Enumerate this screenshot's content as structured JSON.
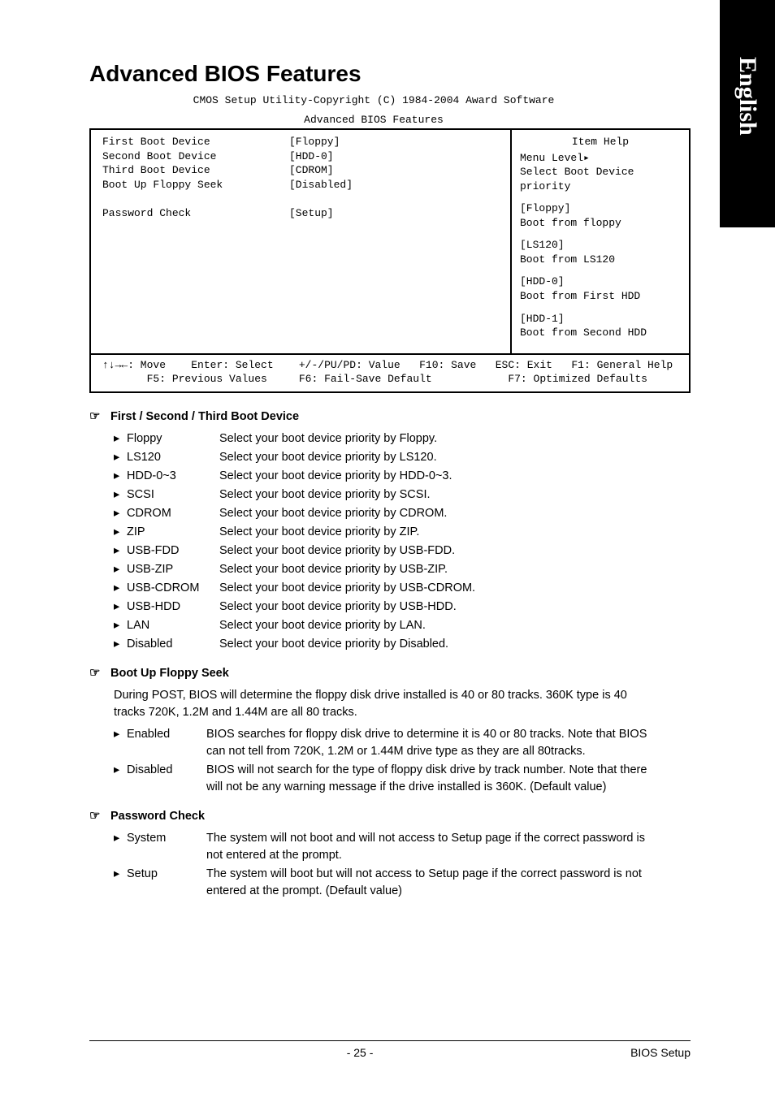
{
  "sideTab": "English",
  "title": "Advanced BIOS Features",
  "biosHeader1": "CMOS Setup Utility-Copyright (C) 1984-2004 Award Software",
  "biosHeader2": "Advanced BIOS Features",
  "biosSettings": [
    {
      "label": "First Boot Device",
      "value": "[Floppy]"
    },
    {
      "label": "Second Boot Device",
      "value": "[HDD-0]"
    },
    {
      "label": "Third Boot Device",
      "value": "[CDROM]"
    },
    {
      "label": "Boot Up Floppy Seek",
      "value": "[Disabled]"
    },
    {
      "label": "",
      "value": ""
    },
    {
      "label": "Password Check",
      "value": "[Setup]"
    }
  ],
  "help": {
    "title": "Item Help",
    "menuLevel": "Menu Level▸",
    "desc": "Select Boot Device priority",
    "items": [
      {
        "opt": "[Floppy]",
        "txt": "Boot from floppy"
      },
      {
        "opt": "[LS120]",
        "txt": "Boot from LS120"
      },
      {
        "opt": "[HDD-0]",
        "txt": "Boot from First HDD"
      },
      {
        "opt": "[HDD-1]",
        "txt": "Boot from Second HDD"
      }
    ]
  },
  "footerKeys": {
    "l1a": "↑↓→←: Move",
    "l1b": "Enter: Select",
    "l1c": "+/-/PU/PD: Value",
    "l1d": "F10: Save",
    "l1e": "ESC: Exit",
    "l1f": "F1: General Help",
    "l2a": "F5: Previous Values",
    "l2b": "F6: Fail-Save Default",
    "l2c": "F7: Optimized Defaults"
  },
  "sec1": {
    "title": "First / Second / Third Boot Device",
    "rows": [
      {
        "name": "Floppy",
        "desc": "Select your boot device priority by Floppy."
      },
      {
        "name": "LS120",
        "desc": "Select your boot device priority by LS120."
      },
      {
        "name": "HDD-0~3",
        "desc": "Select your boot device priority by HDD-0~3."
      },
      {
        "name": "SCSI",
        "desc": "Select your boot device priority by SCSI."
      },
      {
        "name": "CDROM",
        "desc": "Select your boot device priority by CDROM."
      },
      {
        "name": "ZIP",
        "desc": "Select your boot device priority by ZIP."
      },
      {
        "name": "USB-FDD",
        "desc": "Select your boot device priority by USB-FDD."
      },
      {
        "name": "USB-ZIP",
        "desc": "Select your boot device priority by USB-ZIP."
      },
      {
        "name": "USB-CDROM",
        "desc": "Select your boot device priority by USB-CDROM."
      },
      {
        "name": "USB-HDD",
        "desc": "Select your boot device priority by USB-HDD."
      },
      {
        "name": "LAN",
        "desc": "Select your boot device priority by LAN."
      },
      {
        "name": "Disabled",
        "desc": "Select your boot device priority by Disabled."
      }
    ]
  },
  "sec2": {
    "title": "Boot Up Floppy Seek",
    "intro": "During POST, BIOS will determine the floppy disk drive installed is 40 or 80 tracks. 360K type is 40 tracks 720K, 1.2M and 1.44M are all 80 tracks.",
    "rows": [
      {
        "name": "Enabled",
        "desc": "BIOS searches for floppy disk drive to determine it is 40 or 80 tracks. Note that BIOS can not tell from 720K, 1.2M or 1.44M drive type as they are all 80tracks."
      },
      {
        "name": "Disabled",
        "desc": "BIOS will not search for the type of floppy disk drive by track number. Note that there will not be any warning message if the drive installed is 360K. (Default value)"
      }
    ]
  },
  "sec3": {
    "title": "Password Check",
    "rows": [
      {
        "name": "System",
        "desc": "The system will not boot and will not access to Setup page if the correct password is not entered at the prompt."
      },
      {
        "name": "Setup",
        "desc": "The system will boot but will not access to Setup page if the correct password is not entered at the prompt. (Default value)"
      }
    ]
  },
  "pageNumber": "- 25 -",
  "footerLabel": "BIOS Setup",
  "arrowSectionMarker": "☞",
  "bulletMarker": "▸"
}
